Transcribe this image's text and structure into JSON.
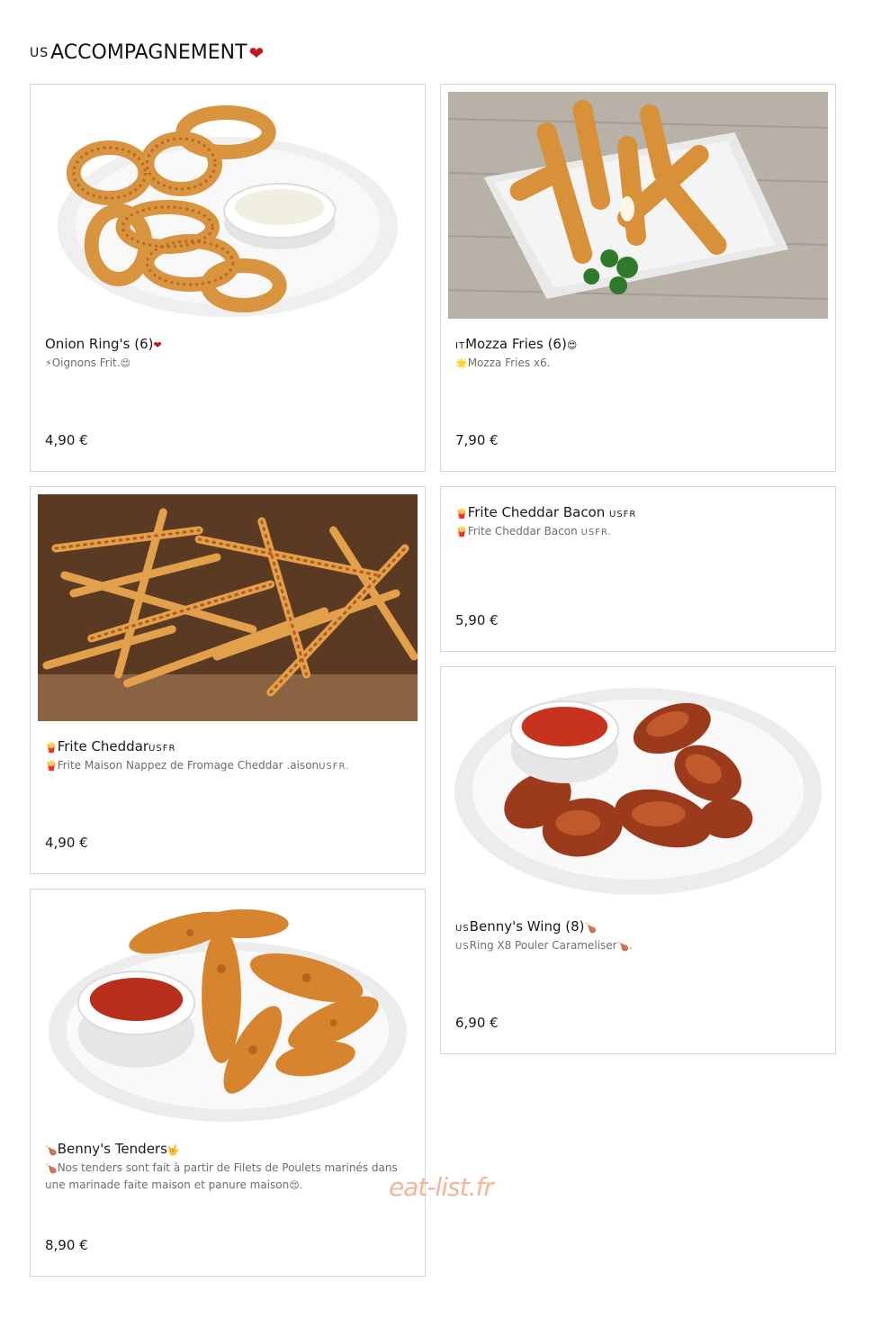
{
  "section": {
    "flag": "US",
    "title": "ACCOMPAGNEMENT",
    "heart": "❤"
  },
  "items": [
    {
      "title_prefix": "",
      "title": "Onion Ring's (6)",
      "title_suffix": "❤",
      "desc_prefix": "⚡",
      "desc": "Oignons Frit.",
      "desc_suffix": "😍",
      "price": "4,90 €",
      "image": "onion-rings-photo"
    },
    {
      "title_prefix": "IT",
      "title": "Mozza Fries (6)",
      "title_suffix": "😍",
      "desc_prefix": "🌟",
      "desc": "Mozza Fries x6.",
      "desc_suffix": "",
      "price": "7,90 €",
      "image": "mozza-sticks-photo"
    },
    {
      "title_prefix": "🍟",
      "title": "Frite Cheddar",
      "title_suffix": "USFR",
      "desc_prefix": "🍟",
      "desc": "Frite Maison Nappez de Fromage Cheddar .aison",
      "desc_suffix": "USFR.",
      "price": "4,90 €",
      "image": "cheddar-fries-photo"
    },
    {
      "title_prefix": "🍟",
      "title": "Frite Cheddar Bacon ",
      "title_suffix": "USFR",
      "desc_prefix": "🍟",
      "desc": "Frite Cheddar Bacon ",
      "desc_suffix": "USFR.",
      "price": "5,90 €",
      "image": ""
    },
    {
      "title_prefix": "🍗",
      "title": "Benny's Tenders",
      "title_suffix": "🤟",
      "desc_prefix": "🍗",
      "desc": "Nos tenders sont fait à partir de Filets de Poulets marinés dans une marinade faite maison et panure maison",
      "desc_suffix": "😍.",
      "price": "8,90 €",
      "image": "chicken-tenders-photo"
    },
    {
      "title_prefix": "US",
      "title": "Benny's Wing (8)",
      "title_suffix": "🍗",
      "desc_prefix": "US",
      "desc": "Ring X8 Pouler Carameliser",
      "desc_suffix": "🍗.",
      "price": "6,90 €",
      "image": "chicken-wings-photo"
    }
  ],
  "watermark": "eat-list.fr",
  "colors": {
    "accent_heart": "#c0181f",
    "border": "#d6d6d6",
    "desc_text": "#6d6d6d"
  }
}
